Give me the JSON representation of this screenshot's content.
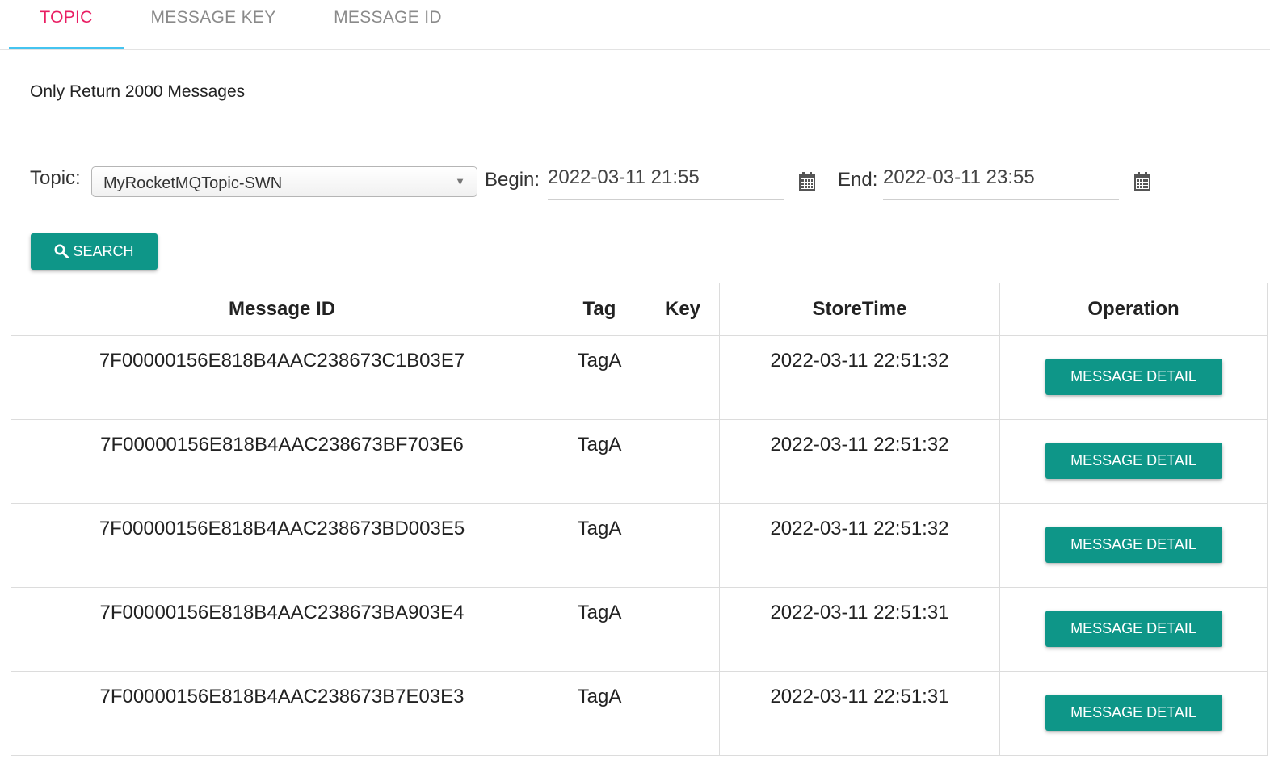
{
  "tabs": [
    {
      "label": "TOPIC",
      "active": true
    },
    {
      "label": "MESSAGE KEY",
      "active": false
    },
    {
      "label": "MESSAGE ID",
      "active": false
    }
  ],
  "notice": "Only Return 2000 Messages",
  "filter": {
    "topic_label": "Topic:",
    "topic_value": "MyRocketMQTopic-SWN",
    "begin_label": "Begin:",
    "begin_value": "2022-03-11 21:55",
    "end_label": "End:",
    "end_value": "2022-03-11 23:55",
    "search_label": "SEARCH"
  },
  "table": {
    "headers": [
      "Message ID",
      "Tag",
      "Key",
      "StoreTime",
      "Operation"
    ],
    "rows": [
      {
        "id": "7F00000156E818B4AAC238673C1B03E7",
        "tag": "TagA",
        "key": "",
        "store_time": "2022-03-11 22:51:32",
        "action": "MESSAGE DETAIL"
      },
      {
        "id": "7F00000156E818B4AAC238673BF703E6",
        "tag": "TagA",
        "key": "",
        "store_time": "2022-03-11 22:51:32",
        "action": "MESSAGE DETAIL"
      },
      {
        "id": "7F00000156E818B4AAC238673BD003E5",
        "tag": "TagA",
        "key": "",
        "store_time": "2022-03-11 22:51:32",
        "action": "MESSAGE DETAIL"
      },
      {
        "id": "7F00000156E818B4AAC238673BA903E4",
        "tag": "TagA",
        "key": "",
        "store_time": "2022-03-11 22:51:31",
        "action": "MESSAGE DETAIL"
      },
      {
        "id": "7F00000156E818B4AAC238673B7E03E3",
        "tag": "TagA",
        "key": "",
        "store_time": "2022-03-11 22:51:31",
        "action": "MESSAGE DETAIL"
      }
    ]
  },
  "colors": {
    "active_tab_text": "#e91e63",
    "active_tab_underline": "#45c4f0",
    "button_bg": "#0e9688"
  },
  "icons": [
    "calendar-icon",
    "search-icon",
    "dropdown-caret-icon"
  ]
}
